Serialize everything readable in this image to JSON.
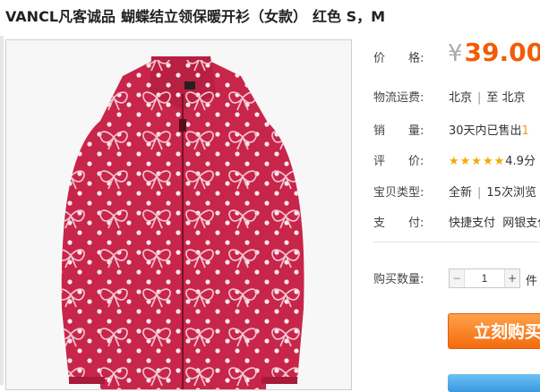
{
  "product": {
    "brand": "VANCL凡客诚品",
    "title": "蝴蝶结立领保暖开衫（女款）",
    "variant": "红色 S，M"
  },
  "details": {
    "price_label": "价　　格:",
    "currency": "¥",
    "price": "39.00",
    "shipping_label": "物流运费:",
    "ship_from": "北京",
    "ship_to_text": "至 北京",
    "sales_label": "销　　量:",
    "sales_text": "30天内已售出",
    "sales_count": "1",
    "rating_label": "评　　价:",
    "rating_stars": "★★★★★",
    "rating_value": "4.9分",
    "type_label": "宝贝类型:",
    "type_value": "全新",
    "views_text": "15次浏览",
    "payment_label": "支　　付:",
    "payment_quick": "快捷支付",
    "payment_bank": "网银支付"
  },
  "purchase": {
    "qty_label": "购买数量:",
    "qty_value": "1",
    "minus_symbol": "−",
    "plus_symbol": "+",
    "unit": "件",
    "buy_now_label": "立刻购买"
  },
  "colors": {
    "price": "#f25c05",
    "buy_button": "#f46b0e",
    "jacket": "#c8254a"
  }
}
